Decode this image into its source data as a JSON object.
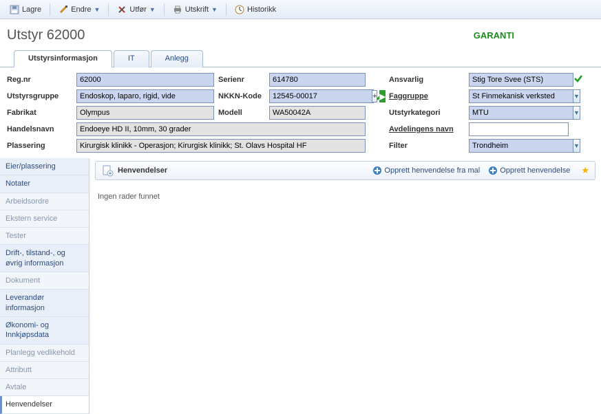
{
  "toolbar": {
    "save": "Lagre",
    "change": "Endre",
    "execute": "Utfør",
    "print": "Utskrift",
    "history": "Historikk"
  },
  "page": {
    "title": "Utstyr 62000",
    "garanti": "GARANTI"
  },
  "tabs": {
    "info": "Utstyrsinformasjon",
    "it": "IT",
    "anlegg": "Anlegg"
  },
  "form": {
    "regnr_lbl": "Reg.nr",
    "regnr": "62000",
    "serienr_lbl": "Serienr",
    "serienr": "614780",
    "ansvarlig_lbl": "Ansvarlig",
    "ansvarlig": "Stig Tore Svee (STS)",
    "gruppe_lbl": "Utstyrsgruppe",
    "gruppe": "Endoskop, laparo, rigid, vide",
    "nkkn_lbl": "NKKN-Kode",
    "nkkn": "12545-00017",
    "faggruppe_lbl": "Faggruppe",
    "faggruppe": "St Finmekanisk verksted",
    "fabrikat_lbl": "Fabrikat",
    "fabrikat": "Olympus",
    "modell_lbl": "Modell",
    "modell": "WA50042A",
    "kategori_lbl": "Utstyrkategori",
    "kategori": "MTU",
    "handelsnavn_lbl": "Handelsnavn",
    "handelsnavn": "Endoeye HD II, 10mm, 30 grader",
    "avdnavn_lbl": "Avdelingens navn",
    "avdnavn": "",
    "plassering_lbl": "Plassering",
    "plassering": "Kirurgisk klinikk - Operasjon; Kirurgisk klinikk; St. Olavs Hospital HF",
    "filter_lbl": "Filter",
    "filter": "Trondheim"
  },
  "sidebar": {
    "items": [
      {
        "label": "Eier/plassering"
      },
      {
        "label": "Notater"
      },
      {
        "label": "Arbeidsordre"
      },
      {
        "label": "Ekstern service"
      },
      {
        "label": "Tester"
      },
      {
        "label": "Drift-, tilstand-, og øvrig informasjon"
      },
      {
        "label": "Dokument"
      },
      {
        "label": "Leverandør informasjon"
      },
      {
        "label": "Økonomi- og Innkjøpsdata"
      },
      {
        "label": "Planlegg vedlikehold"
      },
      {
        "label": "Attributt"
      },
      {
        "label": "Avtale"
      },
      {
        "label": "Henvendelser"
      }
    ]
  },
  "panel": {
    "title": "Henvendelser",
    "create_from_template": "Opprett henvendelse fra mal",
    "create": "Opprett henvendelse",
    "empty": "Ingen rader funnet"
  }
}
